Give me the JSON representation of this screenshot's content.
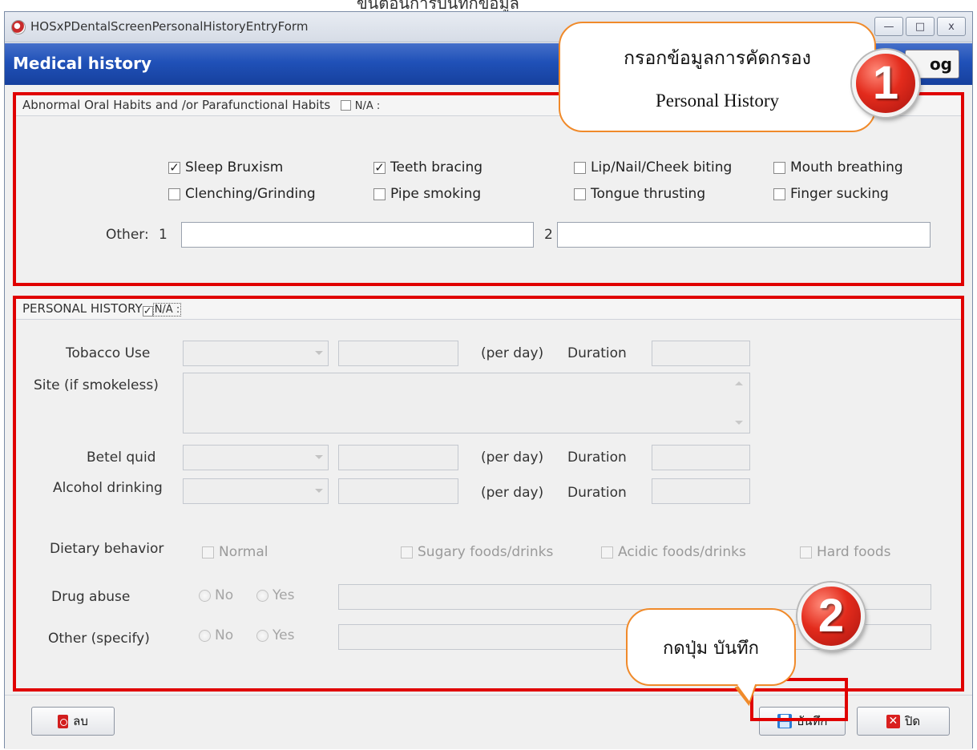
{
  "window": {
    "title": "HOSxPDentalScreenPersonalHistoryEntryForm",
    "minimize": "—",
    "maximize": "□",
    "close": "x"
  },
  "header": {
    "title": "Medical history",
    "log_button": "og"
  },
  "abnormal_habits": {
    "label": "Abnormal Oral Habits and /or Parafunctional Habits",
    "na_label": "N/A :",
    "na_checked": false,
    "items": [
      {
        "label": "Sleep Bruxism",
        "checked": true
      },
      {
        "label": "Teeth bracing",
        "checked": true
      },
      {
        "label": "Lip/Nail/Cheek biting",
        "checked": false
      },
      {
        "label": "Mouth breathing",
        "checked": false
      },
      {
        "label": "Clenching/Grinding",
        "checked": false
      },
      {
        "label": "Pipe smoking",
        "checked": false
      },
      {
        "label": "Tongue thrusting",
        "checked": false
      },
      {
        "label": "Finger sucking",
        "checked": false
      }
    ],
    "other_label": "Other:",
    "other_1": "1",
    "other_2": "2",
    "other_value_1": "",
    "other_value_2": ""
  },
  "personal_history": {
    "label": "PERSONAL HISTORY",
    "na_label": "N/A :",
    "na_checked": true,
    "tobacco_label": "Tobacco Use",
    "site_label": "Site (if smokeless)",
    "betel_label": "Betel quid",
    "alcohol_label": "Alcohol drinking",
    "per_day": "(per day)",
    "duration": "Duration",
    "dietary_label": "Dietary behavior",
    "dietary_options": [
      "Normal",
      "Sugary foods/drinks",
      "Acidic foods/drinks",
      "Hard foods"
    ],
    "drug_label": "Drug abuse",
    "other_label": "Other (specify)",
    "no": "No",
    "yes": "Yes"
  },
  "buttons": {
    "delete": "ลบ",
    "save": "บันทึก",
    "close": "ปิด"
  },
  "callouts": {
    "one_thai": "กรอกข้อมูลการคัดกรอง",
    "one_english": "Personal History",
    "one_number": "1",
    "two_thai": "กดปุ่ม บันทึก",
    "two_number": "2"
  },
  "colors": {
    "header_blue": "#2051b8",
    "highlight_red": "#e00000",
    "callout_orange": "#f08a2a"
  }
}
